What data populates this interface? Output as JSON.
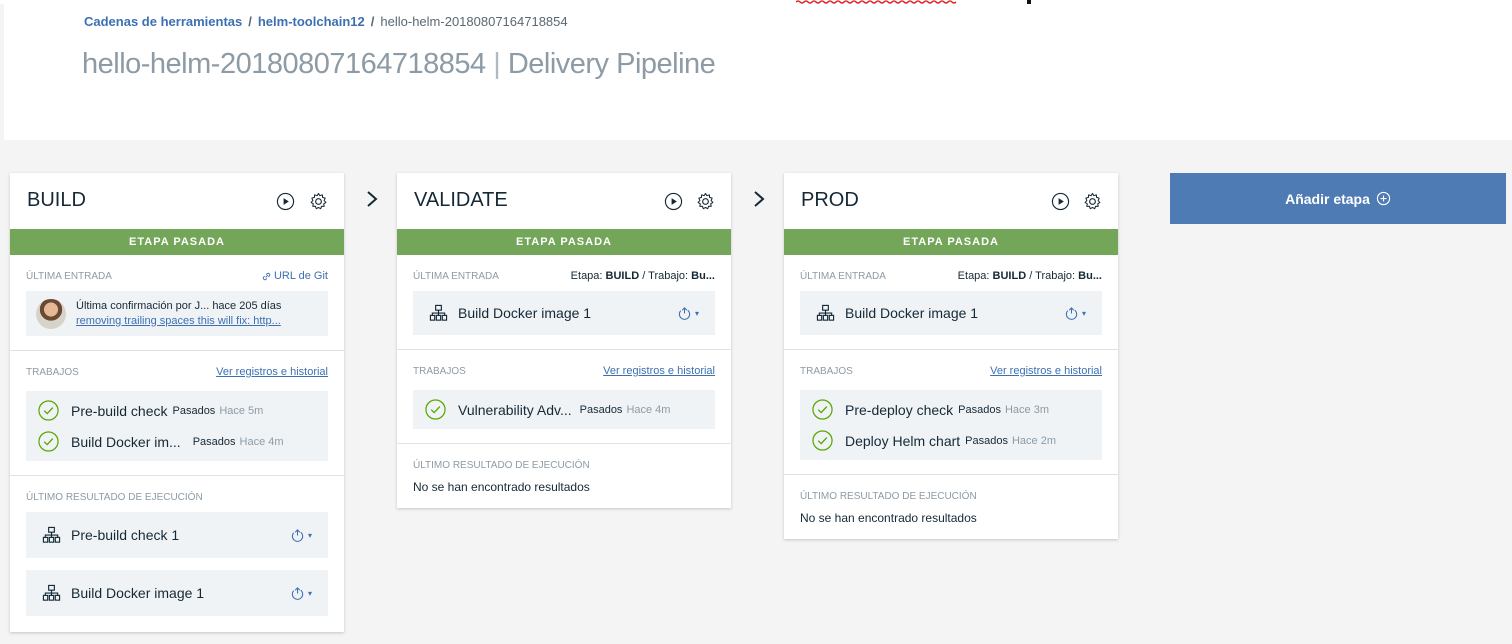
{
  "breadcrumb": {
    "item1": "Cadenas de herramientas",
    "item2": "helm-toolchain12",
    "current": "hello-helm-20180807164718854",
    "separator": "/"
  },
  "page_title": {
    "name": "hello-helm-20180807164718854",
    "separator": "|",
    "suffix": "Delivery Pipeline"
  },
  "add_stage_label": "Añadir etapa",
  "colors": {
    "accent": "#3d70b2",
    "passed": "#74a65a",
    "add_button": "#4f7bb5",
    "success_icon": "#5aa700"
  },
  "stages": [
    {
      "name": "BUILD",
      "status": "ETAPA PASADA",
      "input": {
        "label": "ÚLTIMA ENTRADA",
        "git_link": "URL de Git",
        "commit_line1": "Última confirmación por J... hace 205 días",
        "commit_line2": "removing trailing spaces this will fix: http..."
      },
      "jobs": {
        "label": "TRABAJOS",
        "link": "Ver registros e historial",
        "items": [
          {
            "name": "Pre-build check",
            "status": "Pasados",
            "time": "Hace 5m"
          },
          {
            "name": "Build Docker im...",
            "status": "Pasados",
            "time": "Hace 4m"
          }
        ]
      },
      "results": {
        "label": "ÚLTIMO RESULTADO DE EJECUCIÓN",
        "items": [
          "Pre-build check 1",
          "Build Docker image 1"
        ]
      }
    },
    {
      "name": "VALIDATE",
      "status": "ETAPA PASADA",
      "input": {
        "label": "ÚLTIMA ENTRADA",
        "etapa_label": "Etapa:",
        "etapa_value": "BUILD",
        "slash": "/",
        "trabajo_label": "Trabajo:",
        "trabajo_value": "Bu...",
        "box_label": "Build Docker image 1"
      },
      "jobs": {
        "label": "TRABAJOS",
        "link": "Ver registros e historial",
        "items": [
          {
            "name": "Vulnerability Adv...",
            "status": "Pasados",
            "time": "Hace 4m"
          }
        ]
      },
      "results": {
        "label": "ÚLTIMO RESULTADO DE EJECUCIÓN",
        "empty": "No se han encontrado resultados"
      }
    },
    {
      "name": "PROD",
      "status": "ETAPA PASADA",
      "input": {
        "label": "ÚLTIMA ENTRADA",
        "etapa_label": "Etapa:",
        "etapa_value": "BUILD",
        "slash": "/",
        "trabajo_label": "Trabajo:",
        "trabajo_value": "Bu...",
        "box_label": "Build Docker image 1"
      },
      "jobs": {
        "label": "TRABAJOS",
        "link": "Ver registros e historial",
        "items": [
          {
            "name": "Pre-deploy check",
            "status": "Pasados",
            "time": "Hace 3m"
          },
          {
            "name": "Deploy Helm chart",
            "status": "Pasados",
            "time": "Hace 2m"
          }
        ]
      },
      "results": {
        "label": "ÚLTIMO RESULTADO DE EJECUCIÓN",
        "empty": "No se han encontrado resultados"
      }
    }
  ]
}
